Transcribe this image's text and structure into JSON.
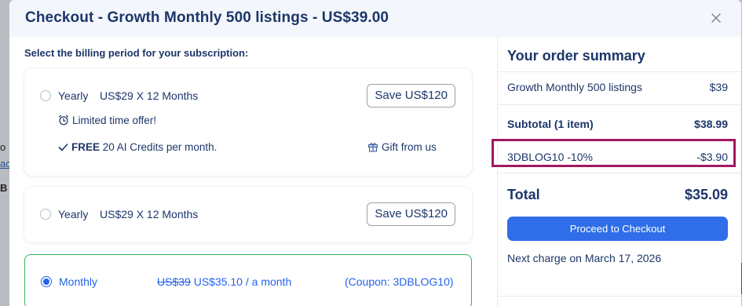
{
  "background": {
    "fragment_1": "o",
    "fragment_2": "ac",
    "fragment_3": "B"
  },
  "modal": {
    "title": "Checkout - Growth Monthly 500 listings - US$39.00",
    "close_icon": "close-icon"
  },
  "billing": {
    "prompt": "Select the billing period for your subscription:",
    "plans": [
      {
        "name": "Yearly",
        "price": "US$29 X 12 Months",
        "save_label": "Save US$120",
        "offer": "Limited time offer!",
        "offer_icon": "alarm-clock-icon",
        "credits_bold": "FREE",
        "credits_rest": "20 AI Credits per month.",
        "credits_icon": "check-icon",
        "gift": "Gift from us",
        "gift_icon": "gift-icon",
        "selected": false
      },
      {
        "name": "Yearly",
        "price": "US$29 X 12 Months",
        "save_label": "Save US$120",
        "selected": false
      },
      {
        "name": "Monthly",
        "old_price": "US$39",
        "new_price": "US$35.10 / a month",
        "coupon_note": "(Coupon: 3DBLOG10)",
        "selected": true
      }
    ]
  },
  "summary": {
    "title": "Your order summary",
    "item_label": "Growth Monthly 500 listings",
    "item_value": "$39",
    "subtotal_label": "Subtotal (1 item)",
    "subtotal_value": "$38.99",
    "coupon_label": "3DBLOG10 -10%",
    "coupon_value": "-$3.90",
    "total_label": "Total",
    "total_value": "$35.09",
    "checkout_label": "Proceed to Checkout",
    "next_charge": "Next charge on March 17, 2026"
  },
  "colors": {
    "accent": "#2f6ee8",
    "title": "#1c3669",
    "selected_border": "#38b35a",
    "highlight_box": "#a1185f"
  }
}
